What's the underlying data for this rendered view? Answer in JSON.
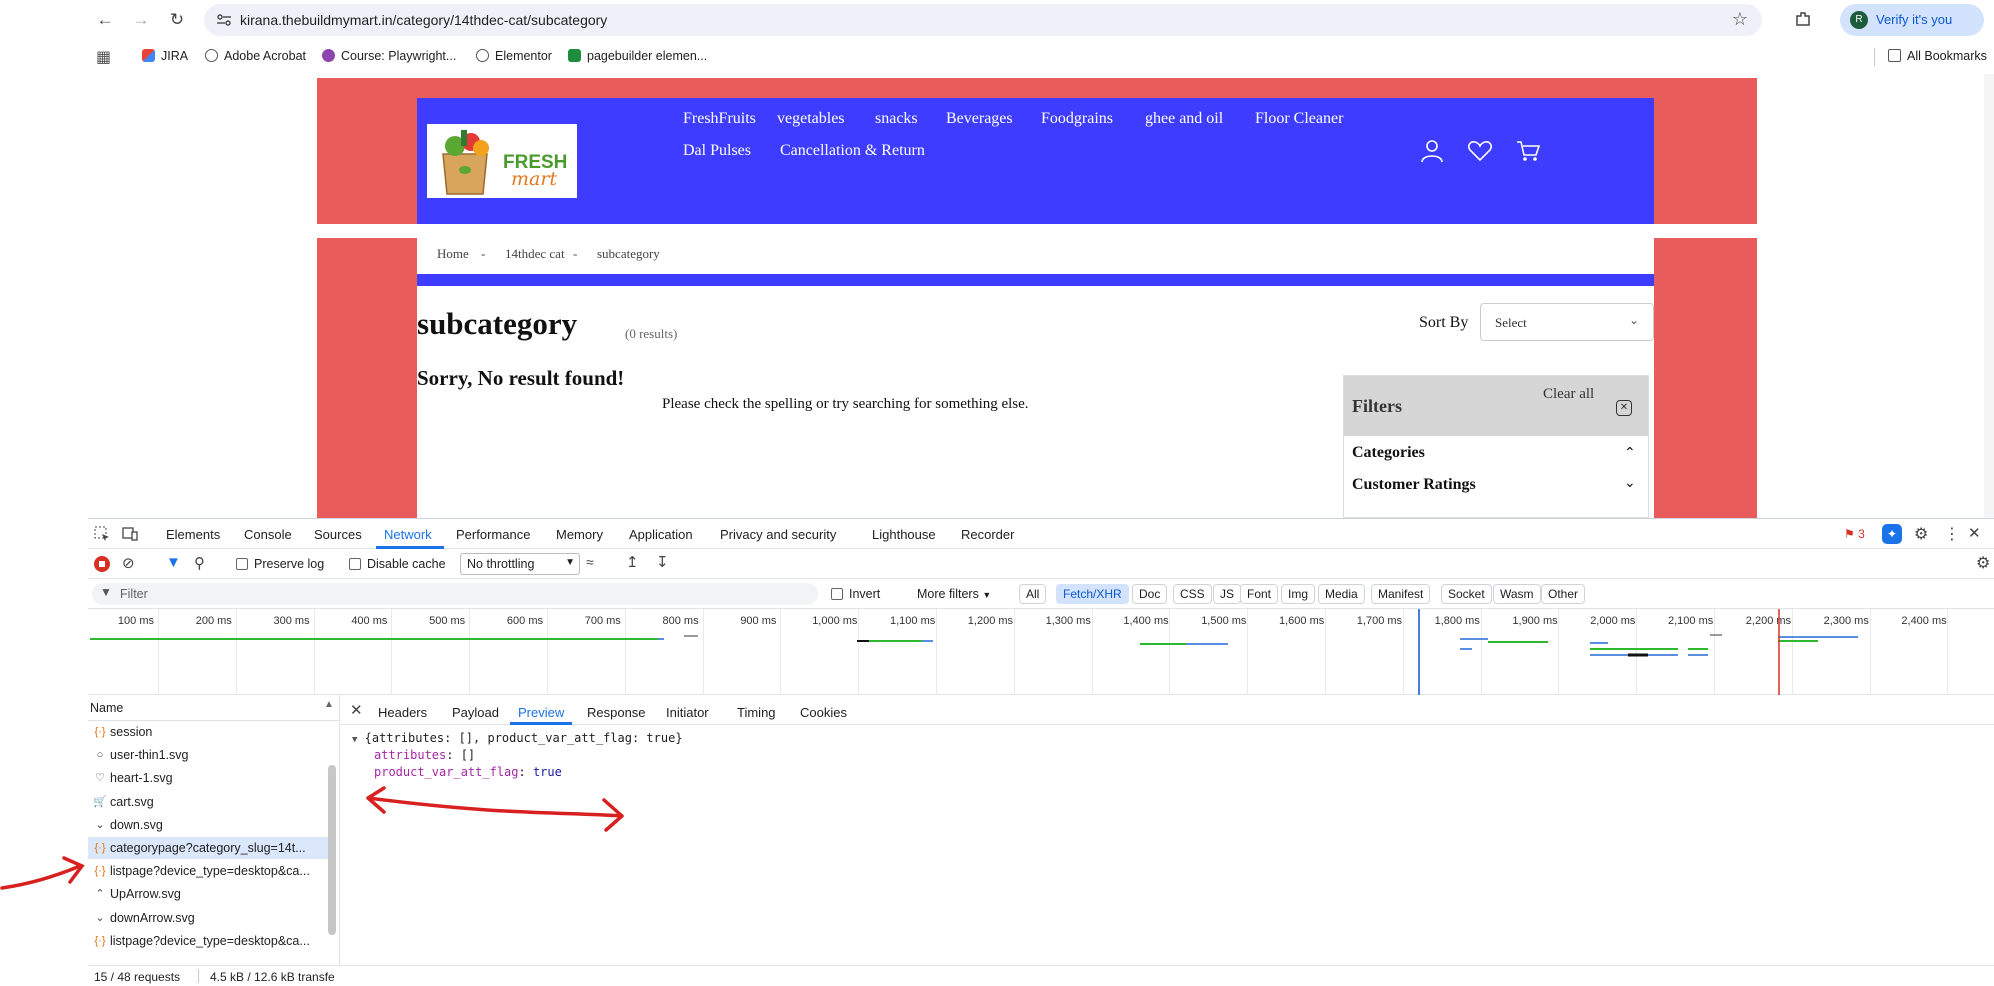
{
  "browser": {
    "url": "kirana.thebuildmymart.in/category/14thdec-cat/subcategory",
    "verify_label": "Verify it's you",
    "profile_initial": "R",
    "bookmarks": [
      "JIRA",
      "Adobe Acrobat",
      "Course: Playwright...",
      "Elementor",
      "pagebuilder elemen..."
    ],
    "all_bookmarks_label": "All Bookmarks"
  },
  "site": {
    "logo_text_1": "FRESH",
    "logo_text_2": "mart",
    "nav": [
      "FreshFruits",
      "vegetables",
      "snacks",
      "Beverages",
      "Foodgrains",
      "ghee and oil",
      "Floor Cleaner",
      "Dal Pulses",
      "Cancellation & Return"
    ],
    "breadcrumb": [
      "Home",
      "14thdec cat",
      "subcategory"
    ],
    "breadcrumb_sep": "-",
    "page_title": "subcategory",
    "result_count": "(0 results)",
    "sort_label": "Sort By",
    "sort_value": "Select",
    "empty_title": "Sorry, No result found!",
    "empty_text": "Please check the spelling or try searching for something else.",
    "filters_title": "Filters",
    "clear_all": "Clear all",
    "filter_sections": [
      "Categories",
      "Customer Ratings"
    ]
  },
  "devtools": {
    "tabs": [
      "Elements",
      "Console",
      "Sources",
      "Network",
      "Performance",
      "Memory",
      "Application",
      "Privacy and security",
      "Lighthouse",
      "Recorder"
    ],
    "active_tab": "Network",
    "issues_count": "3",
    "preserve_log": "Preserve log",
    "disable_cache": "Disable cache",
    "throttling": "No throttling",
    "filter_placeholder": "Filter",
    "invert": "Invert",
    "more_filters": "More filters",
    "type_filters": [
      "All",
      "Fetch/XHR",
      "Doc",
      "CSS",
      "JS",
      "Font",
      "Img",
      "Media",
      "Manifest",
      "Socket",
      "Wasm",
      "Other"
    ],
    "active_type": "Fetch/XHR",
    "timeline_ticks": [
      "100 ms",
      "200 ms",
      "300 ms",
      "400 ms",
      "500 ms",
      "600 ms",
      "700 ms",
      "800 ms",
      "900 ms",
      "1,000 ms",
      "1,100 ms",
      "1,200 ms",
      "1,300 ms",
      "1,400 ms",
      "1,500 ms",
      "1,600 ms",
      "1,700 ms",
      "1,800 ms",
      "1,900 ms",
      "2,000 ms",
      "2,100 ms",
      "2,200 ms",
      "2,300 ms",
      "2,400 ms",
      "2,"
    ],
    "name_header": "Name",
    "requests": [
      {
        "name": "session",
        "icon": "xhr-icon"
      },
      {
        "name": "user-thin1.svg",
        "icon": "user-icon"
      },
      {
        "name": "heart-1.svg",
        "icon": "heart-icon"
      },
      {
        "name": "cart.svg",
        "icon": "cart-icon"
      },
      {
        "name": "down.svg",
        "icon": "chevron-down-icon"
      },
      {
        "name": "categorypage?category_slug=14t...",
        "icon": "xhr-icon"
      },
      {
        "name": "listpage?device_type=desktop&ca...",
        "icon": "xhr-icon"
      },
      {
        "name": "UpArrow.svg",
        "icon": "chevron-up-icon"
      },
      {
        "name": "downArrow.svg",
        "icon": "chevron-down-icon"
      },
      {
        "name": "listpage?device_type=desktop&ca...",
        "icon": "xhr-icon"
      }
    ],
    "selected_request": 5,
    "detail_tabs": [
      "Headers",
      "Payload",
      "Preview",
      "Response",
      "Initiator",
      "Timing",
      "Cookies"
    ],
    "active_detail_tab": "Preview",
    "preview_summary": "{attributes: [], product_var_att_flag: true}",
    "preview_key1": "attributes",
    "preview_val1": "[]",
    "preview_key2": "product_var_att_flag",
    "preview_val2": "true",
    "status_requests": "15 / 48 requests",
    "status_transfer": "4.5 kB / 12.6 kB transfe"
  },
  "colors": {
    "site_red": "#e85c5c",
    "site_blue": "#3d3cff",
    "accent_blue": "#1a73e8",
    "annotation_red": "#d92020"
  }
}
